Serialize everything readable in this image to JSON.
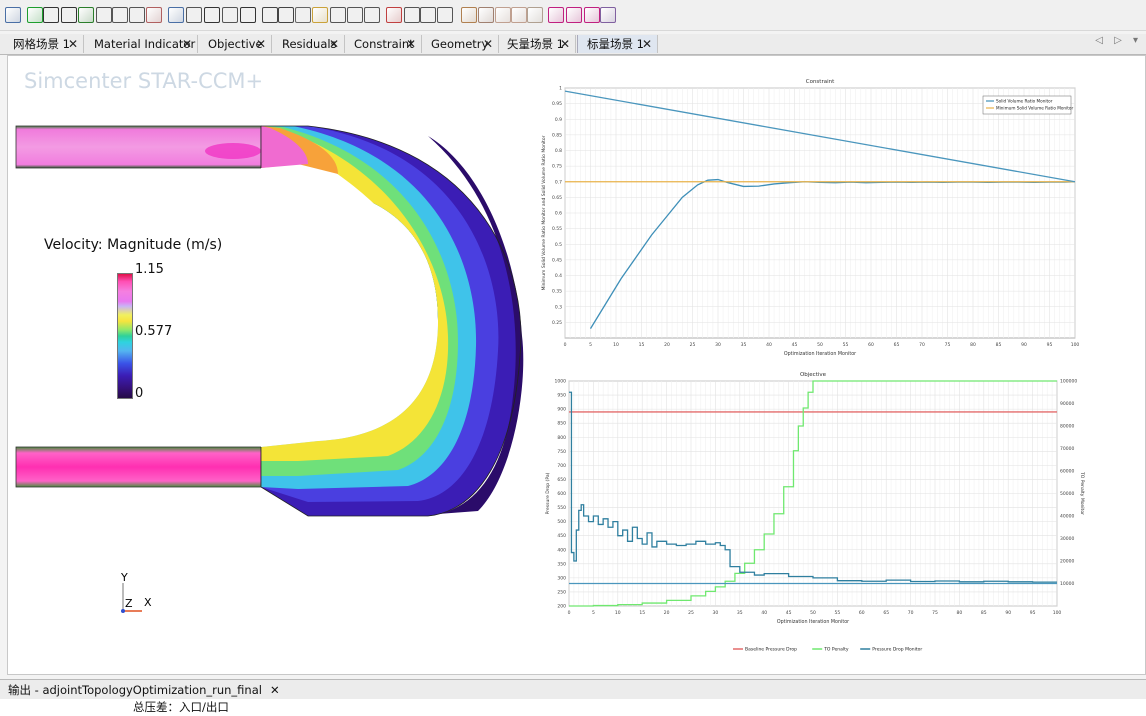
{
  "tabs": [
    {
      "label": "网格场景 1",
      "active": false
    },
    {
      "label": "Material Indicator",
      "active": false
    },
    {
      "label": "Objective",
      "active": false
    },
    {
      "label": "Residuals",
      "active": false
    },
    {
      "label": "Constraint",
      "active": false
    },
    {
      "label": "Geometry",
      "active": false
    },
    {
      "label": "矢量场景 1",
      "active": false
    },
    {
      "label": "标量场景 1",
      "active": true
    }
  ],
  "tab_close_glyph": "✕",
  "tab_controls": "◁ ▷ ▾",
  "scene": {
    "brand": "Simcenter STAR-CCM+",
    "legend": {
      "title": "Velocity: Magnitude (m/s)",
      "max": "1.15",
      "mid": "0.577",
      "min": "0"
    },
    "triad": {
      "y": "Y",
      "z": "Z",
      "x": "X"
    }
  },
  "chart_data": [
    {
      "type": "line",
      "title": "Constraint",
      "xlabel": "Optimization Iteration Monitor",
      "ylabel": "Minimum Solid Volume Ratio Monitor and Solid Volume Ratio Monitor",
      "xlim": [
        0,
        100
      ],
      "ylim": [
        0.2,
        1.0
      ],
      "xticks": [
        0,
        5,
        10,
        15,
        20,
        25,
        30,
        35,
        40,
        45,
        50,
        55,
        60,
        65,
        70,
        75,
        80,
        85,
        90,
        95,
        100
      ],
      "yticks": [
        0.25,
        0.3,
        0.35,
        0.4,
        0.45,
        0.5,
        0.55,
        0.6,
        0.65,
        0.7,
        0.75,
        0.8,
        0.85,
        0.9,
        0.95,
        1
      ],
      "legend_position": "top-right",
      "series": [
        {
          "name": "Solid Volume Ratio Monitor",
          "color": "#3e8fb8",
          "x": [
            5,
            8,
            11,
            14,
            17,
            20,
            23,
            26,
            28,
            30,
            32,
            35,
            38,
            41,
            44,
            47,
            50,
            53,
            56,
            59,
            62,
            65,
            68,
            71,
            74,
            77,
            80,
            83,
            86,
            89,
            92,
            95,
            98,
            100
          ],
          "y": [
            0.23,
            0.31,
            0.39,
            0.46,
            0.53,
            0.59,
            0.65,
            0.69,
            0.705,
            0.707,
            0.697,
            0.685,
            0.686,
            0.693,
            0.697,
            0.7,
            0.698,
            0.697,
            0.699,
            0.697,
            0.698,
            0.699,
            0.698,
            0.699,
            0.698,
            0.699,
            0.699,
            0.698,
            0.699,
            0.699,
            0.698,
            0.699,
            0.699,
            0.7
          ]
        },
        {
          "name": "Minimum Solid Volume Ratio Monitor",
          "color": "#e8b24a",
          "x": [
            0,
            100
          ],
          "y": [
            0.7,
            0.7
          ]
        },
        {
          "name": "",
          "color": "#4a96bd",
          "x": [
            0,
            100
          ],
          "y": [
            0.99,
            0.7
          ]
        }
      ]
    },
    {
      "type": "line",
      "title": "Objective",
      "xlabel": "Optimization Iteration Monitor",
      "ylabel": "Pressure Drop (Pa)",
      "y2label": "TO Penalty Monitor",
      "xlim": [
        0,
        100
      ],
      "ylim": [
        200,
        1000
      ],
      "y2lim": [
        0,
        100000
      ],
      "xticks": [
        0,
        5,
        10,
        15,
        20,
        25,
        30,
        35,
        40,
        45,
        50,
        55,
        60,
        65,
        70,
        75,
        80,
        85,
        90,
        95,
        100
      ],
      "yticks": [
        200,
        250,
        300,
        350,
        400,
        450,
        500,
        550,
        600,
        650,
        700,
        750,
        800,
        850,
        900,
        950,
        1000
      ],
      "y2ticks": [
        10000,
        20000,
        30000,
        40000,
        50000,
        60000,
        70000,
        80000,
        90000,
        100000
      ],
      "legend_position": "bottom",
      "series": [
        {
          "name": "Baseline Pressure Drop",
          "color": "#e36b6b",
          "x": [
            0,
            100
          ],
          "y": [
            890,
            890
          ]
        },
        {
          "name": "TO Penalty",
          "color": "#6fe86f",
          "axis": "y2",
          "x": [
            0,
            5,
            10,
            15,
            20,
            25,
            28,
            30,
            32,
            34,
            36,
            38,
            40,
            42,
            44,
            46,
            47,
            48,
            49,
            50,
            100
          ],
          "y": [
            0,
            200,
            600,
            1300,
            2500,
            4500,
            6500,
            8500,
            11000,
            14500,
            19000,
            25000,
            32000,
            41000,
            53000,
            69000,
            80000,
            88000,
            95000,
            100000,
            100000
          ]
        },
        {
          "name": "Pressure Drop Monitor",
          "color": "#2f7f9f",
          "x": [
            0,
            0.5,
            1,
            1.5,
            2,
            2.5,
            3,
            4,
            5,
            6,
            7,
            8,
            9,
            10,
            11,
            12,
            13,
            14,
            15,
            16,
            17,
            18,
            20,
            22,
            24,
            26,
            28,
            30,
            31,
            32,
            33,
            35,
            38,
            40,
            45,
            50,
            55,
            60,
            65,
            70,
            75,
            80,
            85,
            90,
            95,
            100
          ],
          "y": [
            960,
            390,
            360,
            470,
            540,
            560,
            520,
            500,
            520,
            490,
            510,
            480,
            500,
            450,
            470,
            430,
            480,
            440,
            420,
            460,
            410,
            430,
            420,
            415,
            420,
            430,
            420,
            425,
            415,
            400,
            340,
            320,
            310,
            315,
            305,
            300,
            290,
            288,
            292,
            287,
            289,
            286,
            288,
            286,
            285,
            285
          ]
        },
        {
          "name": "",
          "color": "#4a96bd",
          "x": [
            0,
            100
          ],
          "y": [
            280,
            280
          ]
        }
      ]
    }
  ],
  "output": {
    "tab_label": "输出 - adjointTopologyOptimization_run_final",
    "line": "总压差：入口/出口"
  }
}
